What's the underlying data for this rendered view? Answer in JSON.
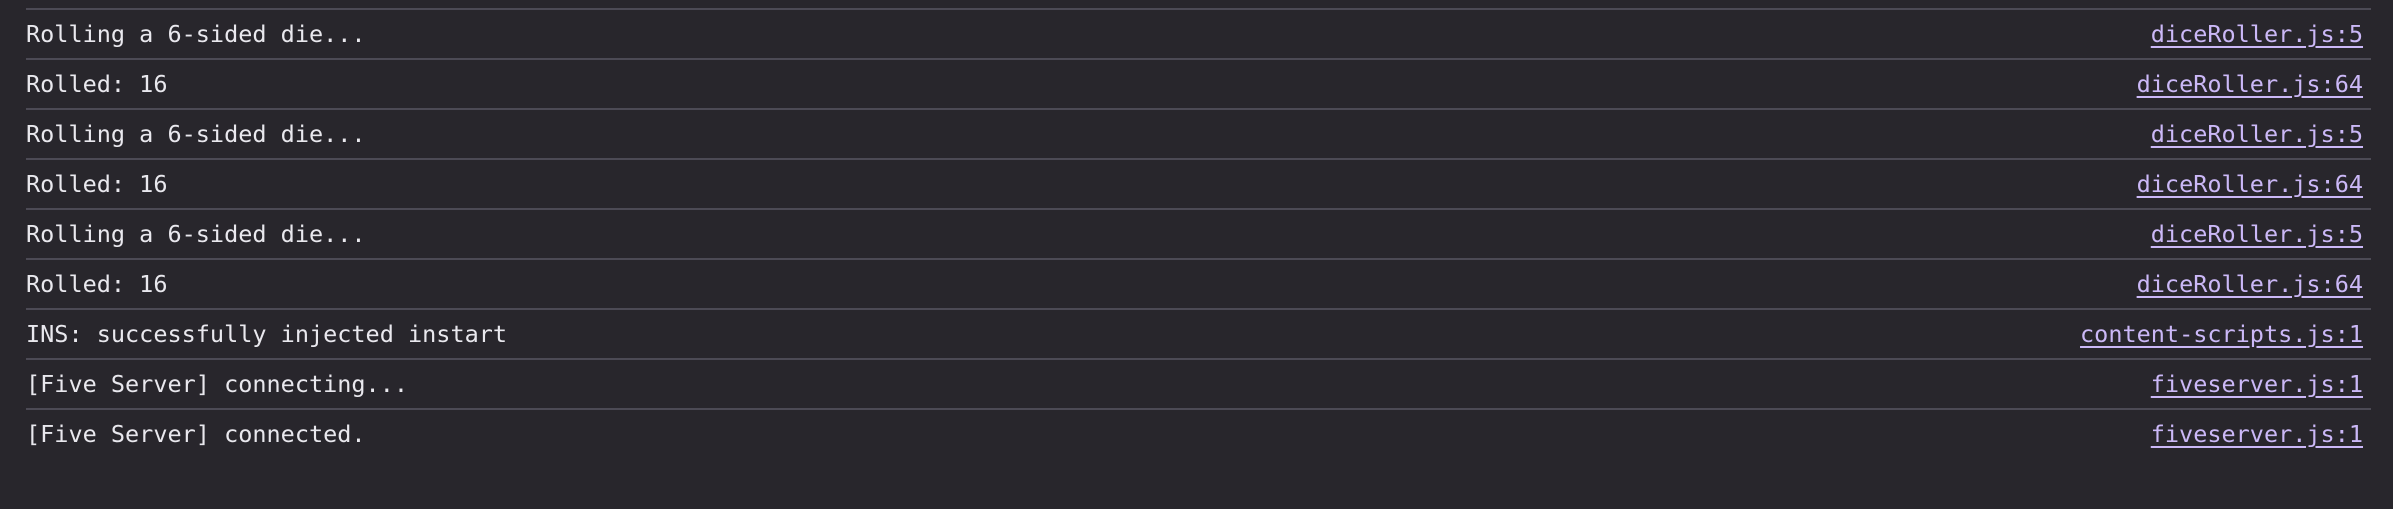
{
  "console": {
    "messages": [
      {
        "text": "Rolling a 6-sided die...",
        "source": "diceRoller.js:5"
      },
      {
        "text": "Rolled: 16",
        "source": "diceRoller.js:64"
      },
      {
        "text": "Rolling a 6-sided die...",
        "source": "diceRoller.js:5"
      },
      {
        "text": "Rolled: 16",
        "source": "diceRoller.js:64"
      },
      {
        "text": "Rolling a 6-sided die...",
        "source": "diceRoller.js:5"
      },
      {
        "text": "Rolled: 16",
        "source": "diceRoller.js:64"
      },
      {
        "text": "INS: successfully injected instart",
        "source": "content-scripts.js:1"
      },
      {
        "text": "[Five Server] connecting...",
        "source": "fiveserver.js:1"
      },
      {
        "text": "[Five Server] connected.",
        "source": "fiveserver.js:1"
      }
    ]
  }
}
